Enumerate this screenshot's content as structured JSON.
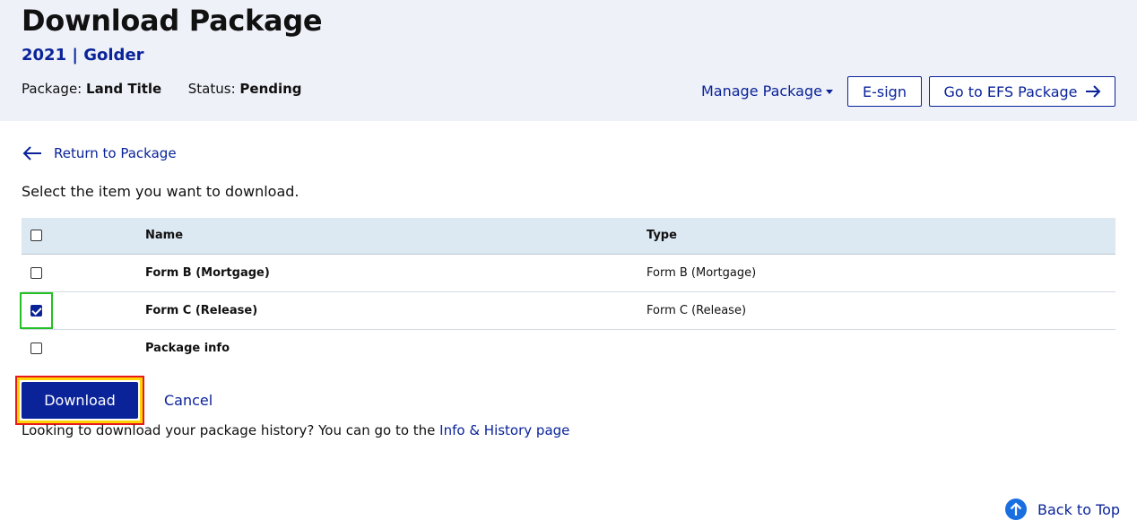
{
  "header": {
    "title": "Download Package",
    "year": "2021",
    "separator": "|",
    "client": "Golder",
    "package_label": "Package:",
    "package_value": "Land Title",
    "status_label": "Status:",
    "status_value": "Pending",
    "manage_label": "Manage Package",
    "esign_label": "E-sign",
    "efs_label": "Go to EFS Package"
  },
  "nav": {
    "return_label": "Return to Package"
  },
  "instructions": "Select the item you want to download.",
  "table": {
    "columns": [
      "Name",
      "Type"
    ],
    "rows": [
      {
        "name": "Form B (Mortgage)",
        "type": "Form B (Mortgage)",
        "checked": false
      },
      {
        "name": "Form C (Release)",
        "type": "Form C (Release)",
        "checked": true
      },
      {
        "name": "Package info",
        "type": "",
        "checked": false
      }
    ]
  },
  "actions": {
    "download_label": "Download",
    "cancel_label": "Cancel"
  },
  "history": {
    "text": "Looking to download your package history? You can go to the",
    "link_label": "Info & History page"
  },
  "footer": {
    "back_to_top_label": "Back to Top"
  },
  "colors": {
    "brand": "#0a2399",
    "header_bg": "#eef1f8",
    "table_header_bg": "#dce8f2",
    "back_top_icon": "#1a6fe0"
  }
}
